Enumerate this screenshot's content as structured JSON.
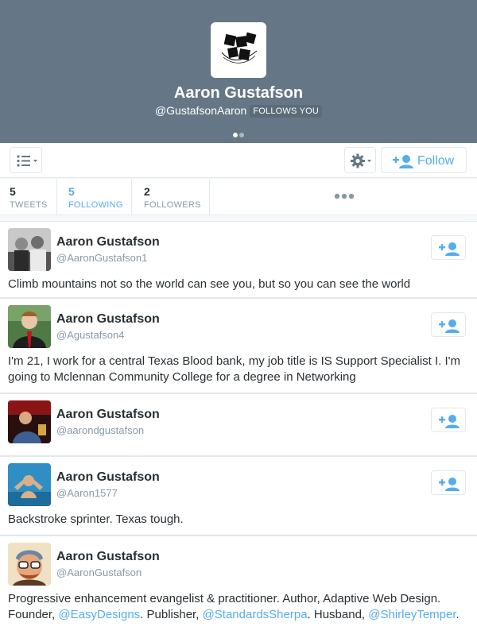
{
  "profile": {
    "name": "Aaron Gustafson",
    "handle": "@GustafsonAaron",
    "follows_badge": "FOLLOWS YOU"
  },
  "colors": {
    "header_bg": "#657786",
    "accent": "#55acee",
    "text": "#292f33",
    "muted": "#8899a6",
    "border": "#e1e8ed"
  },
  "toolbar": {
    "list_icon": "list-icon",
    "gear_icon": "gear-icon",
    "follow_label": "Follow"
  },
  "stats": {
    "tweets": {
      "value": "5",
      "label": "TWEETS"
    },
    "following": {
      "value": "5",
      "label": "FOLLOWING"
    },
    "followers": {
      "value": "2",
      "label": "FOLLOWERS"
    }
  },
  "users": [
    {
      "name": "Aaron Gustafson",
      "handle": "@AaronGustafson1",
      "bio": "Climb mountains not so the world can see you, but so you can see the world"
    },
    {
      "name": "Aaron Gustafson",
      "handle": "@Agustafson4",
      "bio": "I'm 21, I work for a central Texas Blood bank, my job title is IS Support Specialist I. I'm going to Mclennan Community College for a degree in Networking"
    },
    {
      "name": "Aaron Gustafson",
      "handle": "@aarondgustafson",
      "bio": ""
    },
    {
      "name": "Aaron Gustafson",
      "handle": "@Aaron1577",
      "bio": "Backstroke sprinter. Texas tough."
    },
    {
      "name": "Aaron Gustafson",
      "handle": "@AaronGustafson",
      "bio_parts": {
        "p1": "Progressive enhancement evangelist & practitioner. Author, Adaptive Web Design. Founder, ",
        "m1": "@EasyDesigns",
        "p2": ". Publisher, ",
        "m2": "@StandardsSherpa",
        "p3": ". Husband, ",
        "m3": "@ShirleyTemper",
        "p4": "."
      }
    }
  ]
}
